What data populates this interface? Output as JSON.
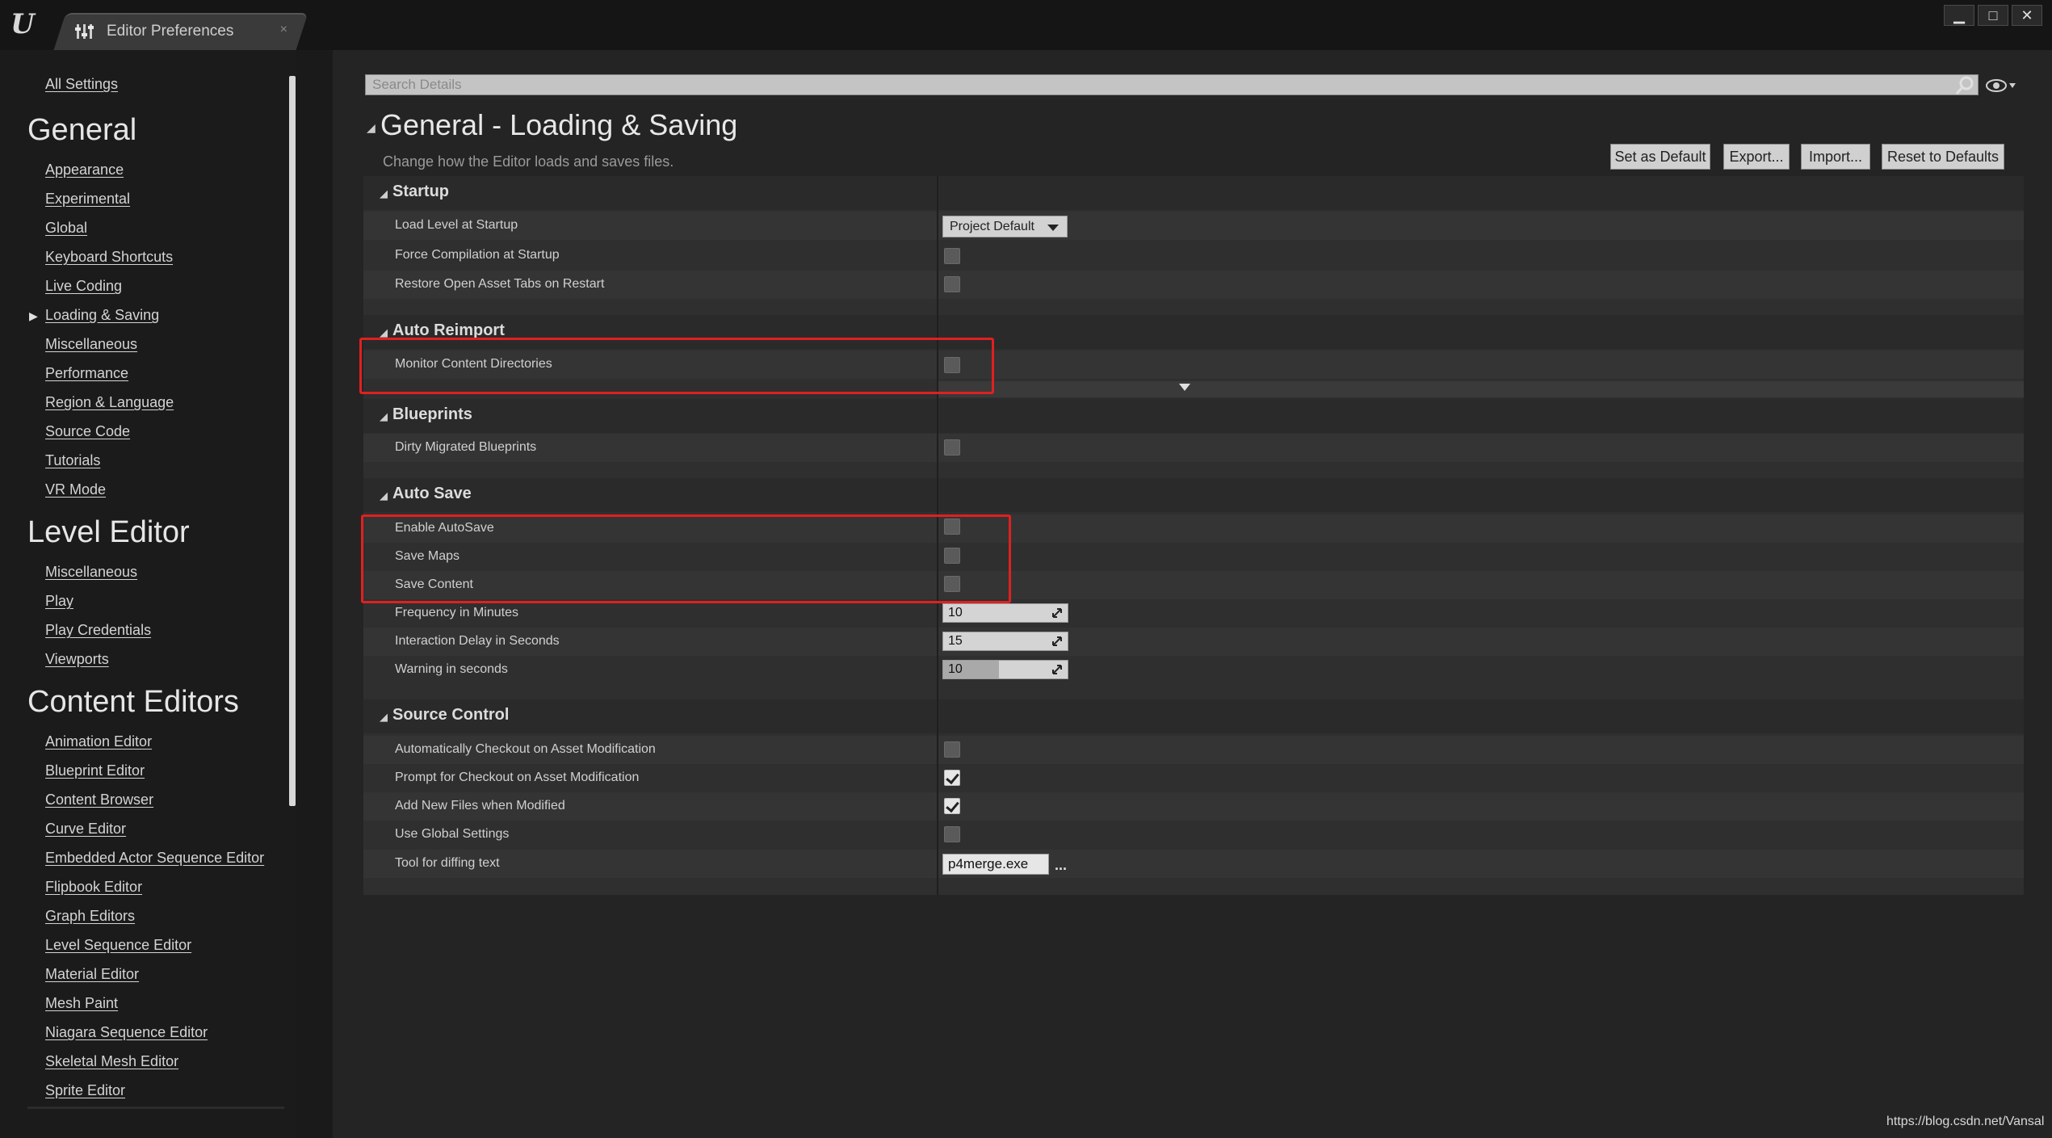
{
  "window": {
    "tab_title": "Editor Preferences",
    "tab_close": "×",
    "controls": {
      "minimize": "▁",
      "maximize": "□",
      "close": "✕"
    }
  },
  "sidebar": {
    "all_settings": "All Settings",
    "sections": [
      {
        "title": "General",
        "items": [
          "Appearance",
          "Experimental",
          "Global",
          "Keyboard Shortcuts",
          "Live Coding",
          "Loading & Saving",
          "Miscellaneous",
          "Performance",
          "Region & Language",
          "Source Code",
          "Tutorials",
          "VR Mode"
        ],
        "selected": "Loading & Saving"
      },
      {
        "title": "Level Editor",
        "items": [
          "Miscellaneous",
          "Play",
          "Play Credentials",
          "Viewports"
        ]
      },
      {
        "title": "Content Editors",
        "items": [
          "Animation Editor",
          "Blueprint Editor",
          "Content Browser",
          "Curve Editor",
          "Embedded Actor Sequence Editor",
          "Flipbook Editor",
          "Graph Editors",
          "Level Sequence Editor",
          "Material Editor",
          "Mesh Paint",
          "Niagara Sequence Editor",
          "Skeletal Mesh Editor",
          "Sprite Editor"
        ]
      }
    ]
  },
  "search": {
    "placeholder": "Search Details",
    "value": ""
  },
  "header": {
    "title": "General - Loading & Saving",
    "description": "Change how the Editor loads and saves files.",
    "buttons": {
      "set_default": "Set as Default",
      "export": "Export...",
      "import": "Import...",
      "reset": "Reset to Defaults"
    }
  },
  "categories": {
    "startup": {
      "label": "Startup",
      "load_level_label": "Load Level at Startup",
      "load_level_value": "Project Default",
      "force_compilation": {
        "label": "Force Compilation at Startup",
        "checked": false
      },
      "restore_tabs": {
        "label": "Restore Open Asset Tabs on Restart",
        "checked": false
      }
    },
    "auto_reimport": {
      "label": "Auto Reimport",
      "monitor": {
        "label": "Monitor Content Directories",
        "checked": false
      }
    },
    "blueprints": {
      "label": "Blueprints",
      "dirty_migrated": {
        "label": "Dirty Migrated Blueprints",
        "checked": false
      }
    },
    "auto_save": {
      "label": "Auto Save",
      "enable": {
        "label": "Enable AutoSave",
        "checked": false
      },
      "save_maps": {
        "label": "Save Maps",
        "checked": false
      },
      "save_content": {
        "label": "Save Content",
        "checked": false
      },
      "frequency": {
        "label": "Frequency in Minutes",
        "value": "10"
      },
      "interaction_delay": {
        "label": "Interaction Delay in Seconds",
        "value": "15"
      },
      "warning": {
        "label": "Warning in seconds",
        "value": "10",
        "slider_fraction": 0.45
      }
    },
    "source_control": {
      "label": "Source Control",
      "auto_checkout": {
        "label": "Automatically Checkout on Asset Modification",
        "checked": false
      },
      "prompt_checkout": {
        "label": "Prompt for Checkout on Asset Modification",
        "checked": true
      },
      "add_new_files": {
        "label": "Add New Files when Modified",
        "checked": true
      },
      "use_global": {
        "label": "Use Global Settings",
        "checked": false
      },
      "diff_tool": {
        "label": "Tool for diffing text",
        "value": "p4merge.exe",
        "browse": "..."
      }
    }
  },
  "watermark": "https://blog.csdn.net/Vansal",
  "colors": {
    "highlight": "#e02020",
    "panel": "#2f2f2f",
    "background": "#242424"
  }
}
